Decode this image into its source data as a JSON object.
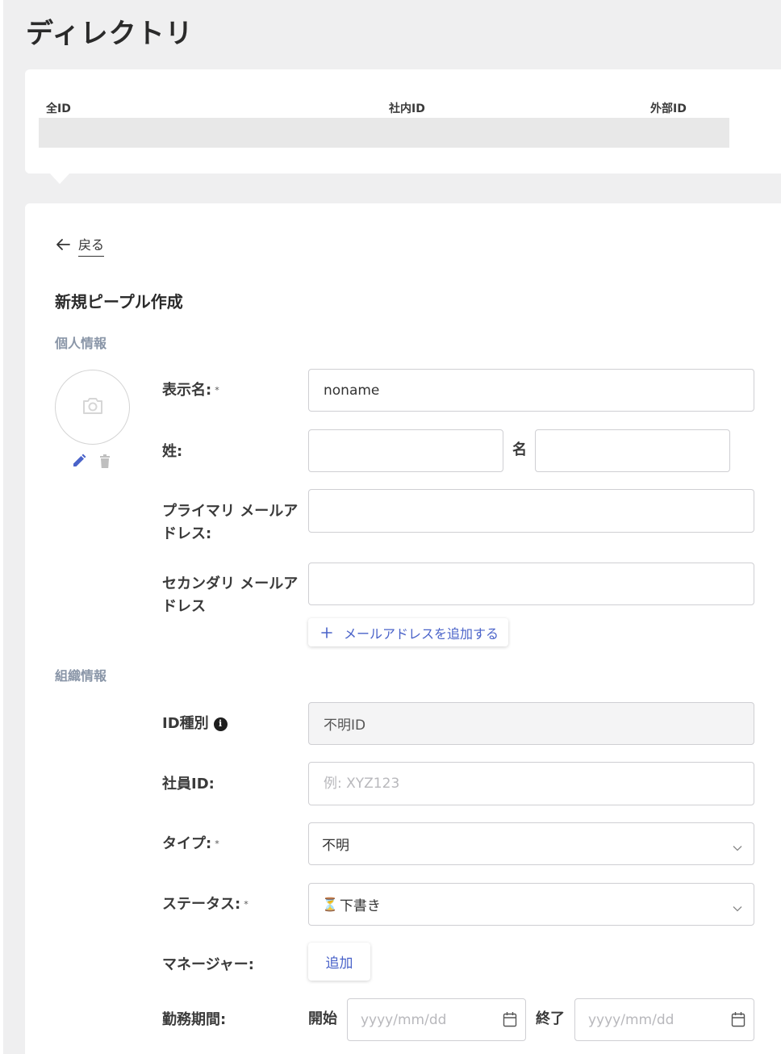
{
  "page": {
    "title": "ディレクトリ"
  },
  "tabs": [
    {
      "label": "全ID"
    },
    {
      "label": "社内ID"
    },
    {
      "label": "外部ID"
    }
  ],
  "form": {
    "back_label": "戻る",
    "title": "新規ピープル作成",
    "personal_section": "個人情報",
    "org_section": "組織情報",
    "display_name": {
      "label": "表示名:",
      "required_mark": "*",
      "value": "noname"
    },
    "last_name": {
      "label": "姓:",
      "value": ""
    },
    "first_name": {
      "label": "名",
      "value": ""
    },
    "primary_email": {
      "label": "プライマリ メールアドレス:",
      "value": ""
    },
    "secondary_email": {
      "label": "セカンダリ メールアドレス",
      "value": ""
    },
    "add_email_label": "メールアドレスを追加する",
    "id_type": {
      "label": "ID種別",
      "value": "不明ID"
    },
    "employee_id": {
      "label": "社員ID:",
      "value": "",
      "placeholder": "例: XYZ123"
    },
    "type": {
      "label": "タイプ:",
      "required_mark": "*",
      "value": "不明"
    },
    "status": {
      "label": "ステータス:",
      "required_mark": "*",
      "icon": "⏳",
      "value": "下書き"
    },
    "manager": {
      "label": "マネージャー:",
      "button_label": "追加"
    },
    "work_period": {
      "label": "勤務期間:",
      "start_label": "開始",
      "start_placeholder": "yyyy/mm/dd",
      "end_label": "終了",
      "end_placeholder": "yyyy/mm/dd"
    }
  },
  "colors": {
    "accent": "#4a63c9",
    "section_label": "#8a96a8",
    "background": "#efeff0"
  },
  "icons": {
    "back": "arrow-left-icon",
    "avatar": "camera-icon",
    "edit": "pencil-icon",
    "delete": "trash-icon",
    "add": "plus-icon",
    "info": "info-icon",
    "dropdown": "chevron-down-icon",
    "calendar": "calendar-icon"
  }
}
